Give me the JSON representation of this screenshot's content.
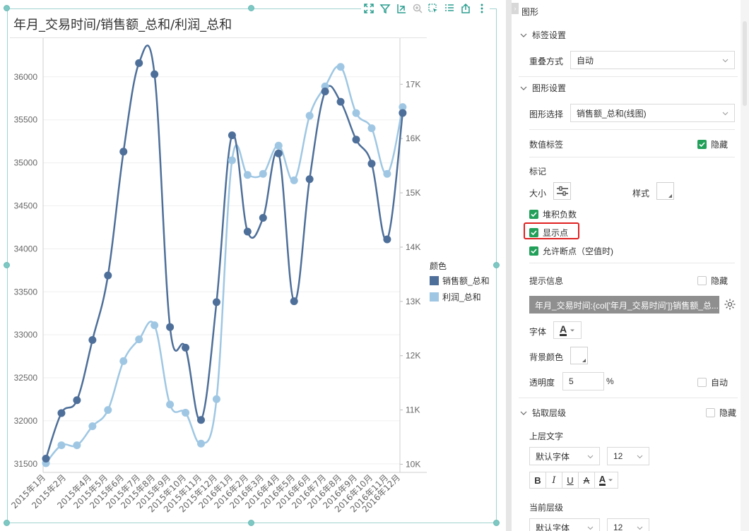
{
  "chart": {
    "title": "年月_交易时间/销售额_总和/利润_总和",
    "legend_title": "颜色",
    "toolbar_icons": [
      "expand-icon",
      "filter-icon",
      "drill-icon",
      "zoom-icon",
      "select-icon",
      "list-icon",
      "export-icon",
      "more-icon"
    ]
  },
  "chart_data": {
    "type": "line",
    "categories": [
      "2015年1月",
      "2015年2月",
      "2015年4月",
      "2015年5月",
      "2015年6月",
      "2015年7月",
      "2015年8月",
      "2015年9月",
      "2015年10月",
      "2015年11月",
      "2015年12月",
      "2016年1月",
      "2016年2月",
      "2016年3月",
      "2016年4月",
      "2016年5月",
      "2016年6月",
      "2016年7月",
      "2016年8月",
      "2016年9月",
      "2016年10月",
      "2016年11月",
      "2016年12月"
    ],
    "category_positions": [
      1,
      2,
      3,
      4,
      5,
      6,
      7,
      8,
      9,
      10,
      11,
      12,
      13,
      14,
      15,
      16,
      17,
      18,
      19,
      20,
      21,
      22,
      23
    ],
    "series": [
      {
        "name": "销售额_总和",
        "axis": "left",
        "color": "#4e6f99",
        "values": [
          31560,
          32090,
          32240,
          32940,
          33690,
          35130,
          36160,
          36030,
          33090,
          32850,
          32010,
          33380,
          35320,
          34200,
          34360,
          35110,
          33390,
          34810,
          35830,
          35710,
          35270,
          34990,
          34110,
          35580
        ]
      },
      {
        "name": "利润_总和",
        "axis": "right",
        "color": "#9fc7e3",
        "values": [
          10020,
          10350,
          10350,
          10700,
          11000,
          11900,
          12300,
          12560,
          11100,
          10950,
          10380,
          11200,
          15600,
          15330,
          15350,
          15870,
          15230,
          16420,
          16960,
          17320,
          16470,
          16190,
          15350,
          16580
        ]
      }
    ],
    "x_points_note": "",
    "left_axis": {
      "ticks": [
        "31500",
        "32000",
        "32500",
        "33000",
        "33500",
        "34000",
        "34500",
        "35000",
        "35500",
        "36000"
      ],
      "ylim": [
        31400,
        36450
      ]
    },
    "right_axis": {
      "ticks": [
        "10K",
        "11K",
        "12K",
        "13K",
        "14K",
        "15K",
        "16K",
        "17K"
      ],
      "ylim": [
        9850,
        17850
      ]
    },
    "x_tick_labels": [
      "2015年1月",
      "2015年2月",
      "2015年4月",
      "2015年5月",
      "2015年6月",
      "2015年7月",
      "2015年8月",
      "2015年9月",
      "2015年10月",
      "2015年11月",
      "2015年12月",
      "2016年1月",
      "2016年2月",
      "2016年3月",
      "2016年4月",
      "2016年5月",
      "2016年6月",
      "2016年7月",
      "2016年8月",
      "2016年9月",
      "2016年10月",
      "2016年11月",
      "2016年12月"
    ],
    "grid": true,
    "legend_placement": "right"
  },
  "panel": {
    "title": "图形",
    "label_settings": {
      "header": "标签设置",
      "overlap_label": "重叠方式",
      "overlap_value": "自动"
    },
    "graph_settings": {
      "header": "图形设置",
      "select_label": "图形选择",
      "select_value": "销售额_总和(线图)",
      "value_label": "数值标签",
      "value_hide": "隐藏",
      "marker_label": "标记",
      "size_label": "大小",
      "style_label": "样式",
      "stack_negative": "堆积负数",
      "show_points": "显示点",
      "allow_break": "允许断点（空值时)",
      "tooltip_label": "提示信息",
      "tooltip_hide": "隐藏",
      "tooltip_value": "年月_交易时间:{col['年月_交易时间']}销售额_总...",
      "font_label": "字体",
      "font_glyph": "A",
      "bg_label": "背景颜色",
      "opacity_label": "透明度",
      "opacity_value": "5",
      "opacity_unit": "%",
      "opacity_auto": "自动"
    },
    "drill": {
      "header": "钻取层级",
      "hide": "隐藏",
      "upper_text": "上层文字",
      "font_value": "默认字体",
      "size_value": "12",
      "format_buttons": [
        "B",
        "I",
        "U",
        "A",
        "A"
      ],
      "current_level": "当前层级",
      "font_value2": "默认字体",
      "size_value2": "12"
    },
    "colors": {
      "check": "#22a05a",
      "highlight": "#e02020"
    }
  }
}
